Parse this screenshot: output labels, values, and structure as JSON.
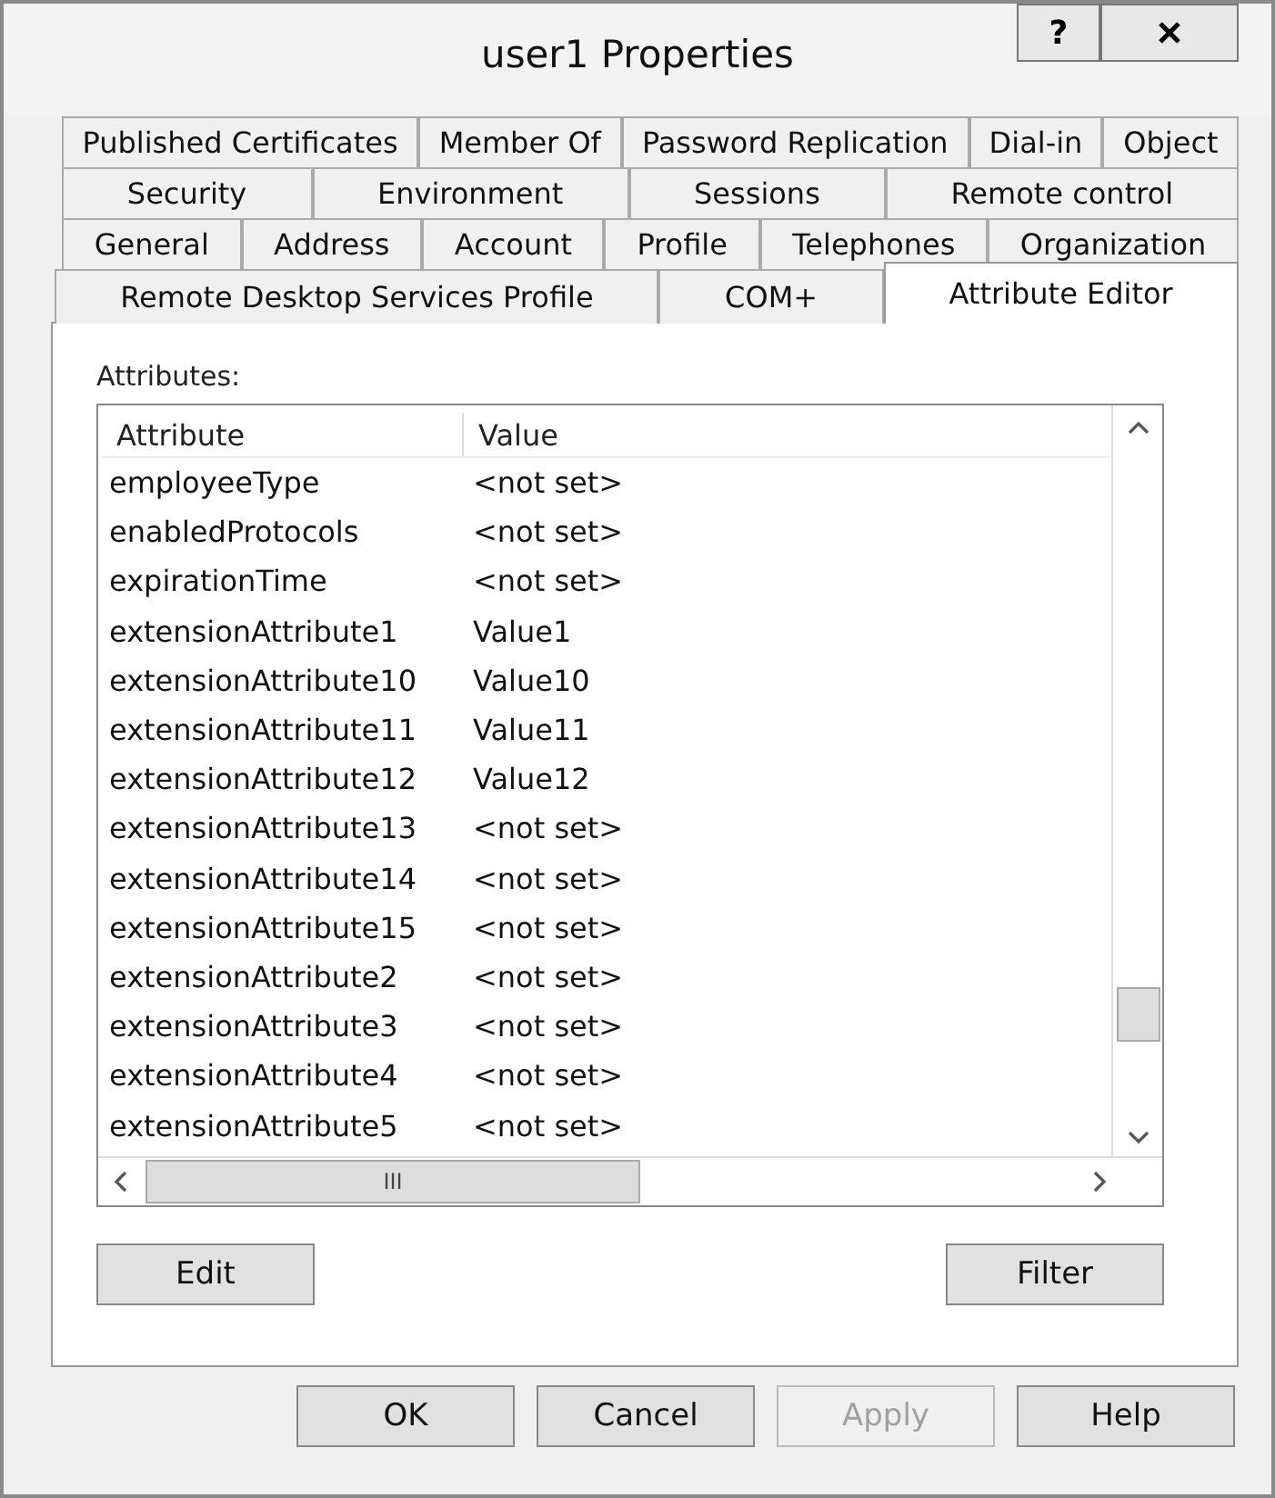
{
  "window": {
    "title": "user1 Properties",
    "help_button": "?"
  },
  "tab_rows": [
    [
      {
        "label": "Published Certificates",
        "selected": false
      },
      {
        "label": "Member Of",
        "selected": false
      },
      {
        "label": "Password Replication",
        "selected": false
      },
      {
        "label": "Dial-in",
        "selected": false
      },
      {
        "label": "Object",
        "selected": false
      }
    ],
    [
      {
        "label": "Security",
        "selected": false
      },
      {
        "label": "Environment",
        "selected": false
      },
      {
        "label": "Sessions",
        "selected": false
      },
      {
        "label": "Remote control",
        "selected": false
      }
    ],
    [
      {
        "label": "General",
        "selected": false
      },
      {
        "label": "Address",
        "selected": false
      },
      {
        "label": "Account",
        "selected": false
      },
      {
        "label": "Profile",
        "selected": false
      },
      {
        "label": "Telephones",
        "selected": false
      },
      {
        "label": "Organization",
        "selected": false
      }
    ],
    [
      {
        "label": "Remote Desktop Services Profile",
        "selected": false
      },
      {
        "label": "COM+",
        "selected": false
      },
      {
        "label": "Attribute Editor",
        "selected": true
      }
    ]
  ],
  "attributes": {
    "label": "Attributes:",
    "columns": [
      "Attribute",
      "Value"
    ],
    "rows": [
      [
        "employeeType",
        "<not set>"
      ],
      [
        "enabledProtocols",
        "<not set>"
      ],
      [
        "expirationTime",
        "<not set>"
      ],
      [
        "extensionAttribute1",
        "Value1"
      ],
      [
        "extensionAttribute10",
        "Value10"
      ],
      [
        "extensionAttribute11",
        "Value11"
      ],
      [
        "extensionAttribute12",
        "Value12"
      ],
      [
        "extensionAttribute13",
        "<not set>"
      ],
      [
        "extensionAttribute14",
        "<not set>"
      ],
      [
        "extensionAttribute15",
        "<not set>"
      ],
      [
        "extensionAttribute2",
        "<not set>"
      ],
      [
        "extensionAttribute3",
        "<not set>"
      ],
      [
        "extensionAttribute4",
        "<not set>"
      ],
      [
        "extensionAttribute5",
        "<not set>"
      ]
    ],
    "scroll_grip": "III"
  },
  "panel_buttons": [
    "Edit",
    "Filter"
  ],
  "buttons": [
    {
      "label": "OK",
      "disabled": false
    },
    {
      "label": "Cancel",
      "disabled": false
    },
    {
      "label": "Apply",
      "disabled": true
    },
    {
      "label": "Help",
      "disabled": false
    }
  ]
}
